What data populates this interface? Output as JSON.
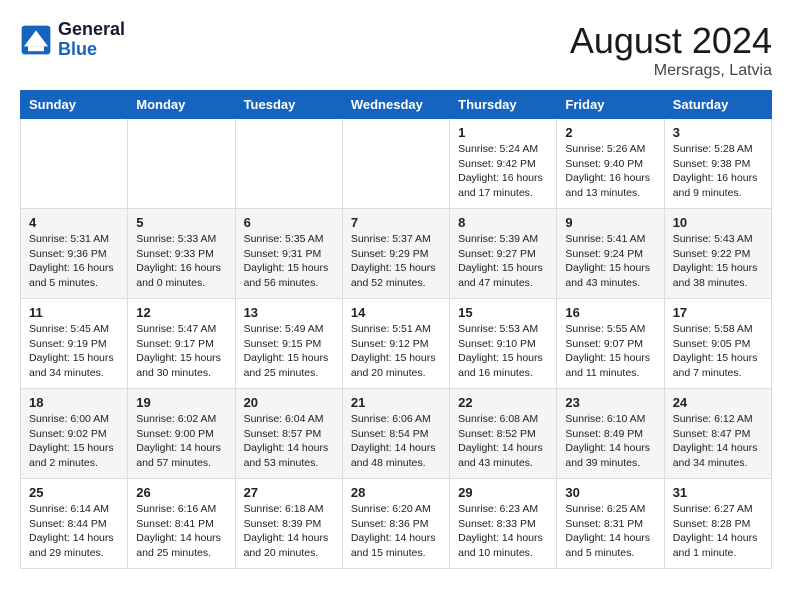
{
  "logo": {
    "line1": "General",
    "line2": "Blue"
  },
  "title": "August 2024",
  "location": "Mersrags, Latvia",
  "days_of_week": [
    "Sunday",
    "Monday",
    "Tuesday",
    "Wednesday",
    "Thursday",
    "Friday",
    "Saturday"
  ],
  "weeks": [
    [
      {
        "day": "",
        "content": ""
      },
      {
        "day": "",
        "content": ""
      },
      {
        "day": "",
        "content": ""
      },
      {
        "day": "",
        "content": ""
      },
      {
        "day": "1",
        "content": "Sunrise: 5:24 AM\nSunset: 9:42 PM\nDaylight: 16 hours\nand 17 minutes."
      },
      {
        "day": "2",
        "content": "Sunrise: 5:26 AM\nSunset: 9:40 PM\nDaylight: 16 hours\nand 13 minutes."
      },
      {
        "day": "3",
        "content": "Sunrise: 5:28 AM\nSunset: 9:38 PM\nDaylight: 16 hours\nand 9 minutes."
      }
    ],
    [
      {
        "day": "4",
        "content": "Sunrise: 5:31 AM\nSunset: 9:36 PM\nDaylight: 16 hours\nand 5 minutes."
      },
      {
        "day": "5",
        "content": "Sunrise: 5:33 AM\nSunset: 9:33 PM\nDaylight: 16 hours\nand 0 minutes."
      },
      {
        "day": "6",
        "content": "Sunrise: 5:35 AM\nSunset: 9:31 PM\nDaylight: 15 hours\nand 56 minutes."
      },
      {
        "day": "7",
        "content": "Sunrise: 5:37 AM\nSunset: 9:29 PM\nDaylight: 15 hours\nand 52 minutes."
      },
      {
        "day": "8",
        "content": "Sunrise: 5:39 AM\nSunset: 9:27 PM\nDaylight: 15 hours\nand 47 minutes."
      },
      {
        "day": "9",
        "content": "Sunrise: 5:41 AM\nSunset: 9:24 PM\nDaylight: 15 hours\nand 43 minutes."
      },
      {
        "day": "10",
        "content": "Sunrise: 5:43 AM\nSunset: 9:22 PM\nDaylight: 15 hours\nand 38 minutes."
      }
    ],
    [
      {
        "day": "11",
        "content": "Sunrise: 5:45 AM\nSunset: 9:19 PM\nDaylight: 15 hours\nand 34 minutes."
      },
      {
        "day": "12",
        "content": "Sunrise: 5:47 AM\nSunset: 9:17 PM\nDaylight: 15 hours\nand 30 minutes."
      },
      {
        "day": "13",
        "content": "Sunrise: 5:49 AM\nSunset: 9:15 PM\nDaylight: 15 hours\nand 25 minutes."
      },
      {
        "day": "14",
        "content": "Sunrise: 5:51 AM\nSunset: 9:12 PM\nDaylight: 15 hours\nand 20 minutes."
      },
      {
        "day": "15",
        "content": "Sunrise: 5:53 AM\nSunset: 9:10 PM\nDaylight: 15 hours\nand 16 minutes."
      },
      {
        "day": "16",
        "content": "Sunrise: 5:55 AM\nSunset: 9:07 PM\nDaylight: 15 hours\nand 11 minutes."
      },
      {
        "day": "17",
        "content": "Sunrise: 5:58 AM\nSunset: 9:05 PM\nDaylight: 15 hours\nand 7 minutes."
      }
    ],
    [
      {
        "day": "18",
        "content": "Sunrise: 6:00 AM\nSunset: 9:02 PM\nDaylight: 15 hours\nand 2 minutes."
      },
      {
        "day": "19",
        "content": "Sunrise: 6:02 AM\nSunset: 9:00 PM\nDaylight: 14 hours\nand 57 minutes."
      },
      {
        "day": "20",
        "content": "Sunrise: 6:04 AM\nSunset: 8:57 PM\nDaylight: 14 hours\nand 53 minutes."
      },
      {
        "day": "21",
        "content": "Sunrise: 6:06 AM\nSunset: 8:54 PM\nDaylight: 14 hours\nand 48 minutes."
      },
      {
        "day": "22",
        "content": "Sunrise: 6:08 AM\nSunset: 8:52 PM\nDaylight: 14 hours\nand 43 minutes."
      },
      {
        "day": "23",
        "content": "Sunrise: 6:10 AM\nSunset: 8:49 PM\nDaylight: 14 hours\nand 39 minutes."
      },
      {
        "day": "24",
        "content": "Sunrise: 6:12 AM\nSunset: 8:47 PM\nDaylight: 14 hours\nand 34 minutes."
      }
    ],
    [
      {
        "day": "25",
        "content": "Sunrise: 6:14 AM\nSunset: 8:44 PM\nDaylight: 14 hours\nand 29 minutes."
      },
      {
        "day": "26",
        "content": "Sunrise: 6:16 AM\nSunset: 8:41 PM\nDaylight: 14 hours\nand 25 minutes."
      },
      {
        "day": "27",
        "content": "Sunrise: 6:18 AM\nSunset: 8:39 PM\nDaylight: 14 hours\nand 20 minutes."
      },
      {
        "day": "28",
        "content": "Sunrise: 6:20 AM\nSunset: 8:36 PM\nDaylight: 14 hours\nand 15 minutes."
      },
      {
        "day": "29",
        "content": "Sunrise: 6:23 AM\nSunset: 8:33 PM\nDaylight: 14 hours\nand 10 minutes."
      },
      {
        "day": "30",
        "content": "Sunrise: 6:25 AM\nSunset: 8:31 PM\nDaylight: 14 hours\nand 5 minutes."
      },
      {
        "day": "31",
        "content": "Sunrise: 6:27 AM\nSunset: 8:28 PM\nDaylight: 14 hours\nand 1 minute."
      }
    ]
  ]
}
